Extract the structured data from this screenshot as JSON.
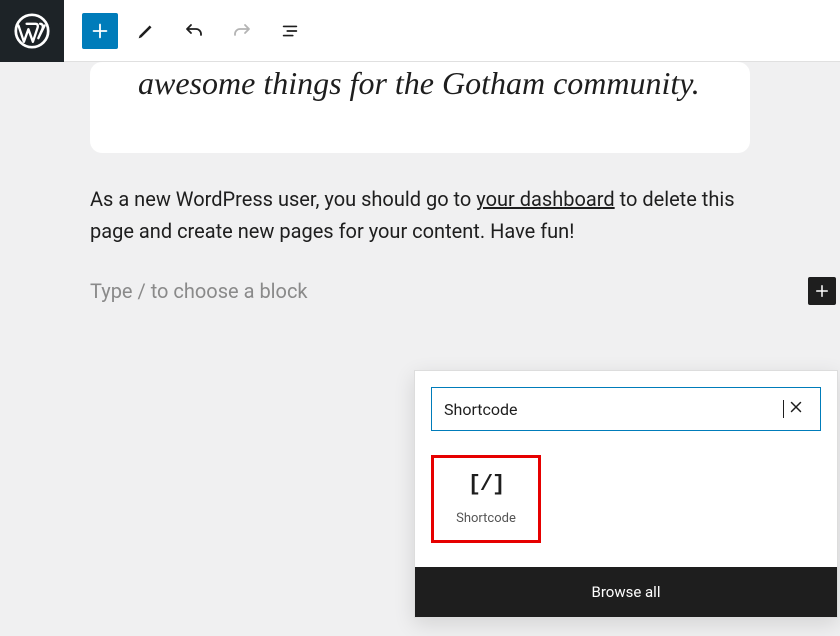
{
  "quote": {
    "visible_text": "awesome things for the Gotham community."
  },
  "paragraph": {
    "before_link": "As a new WordPress user, you should go to ",
    "link_text": "your dashboard",
    "after_link": " to delete this page and create new pages for your content. Have fun!"
  },
  "block_placeholder": "Type / to choose a block",
  "inserter": {
    "search_value": "Shortcode",
    "result": {
      "icon_text": "[/]",
      "label": "Shortcode"
    },
    "browse_label": "Browse all"
  }
}
